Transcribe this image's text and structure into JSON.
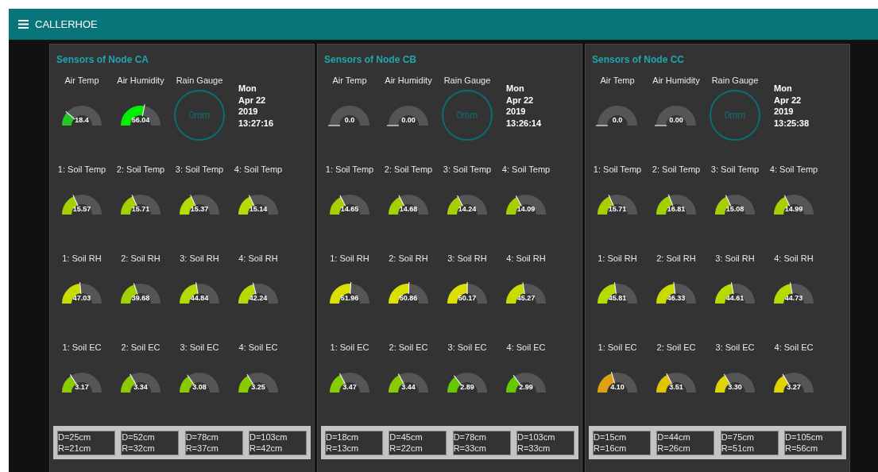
{
  "header": {
    "title": "CALLERHOE"
  },
  "nodes": [
    {
      "title": "Sensors of Node CA",
      "air_gauges": [
        {
          "label": "Air Temp",
          "value": "18.4",
          "color": "#22c822"
        },
        {
          "label": "Air Humidity",
          "value": "56.04",
          "color": "#00ee00"
        }
      ],
      "rain_gauge": {
        "label": "Rain Gauge",
        "reading": "0mm"
      },
      "date_lines": [
        "Mon",
        "Apr 22",
        "2019",
        "13:27:16"
      ],
      "rows": [
        {
          "gauges": [
            {
              "label": "1: Soil Temp",
              "value": "15.57",
              "color": "#a4d000"
            },
            {
              "label": "2: Soil Temp",
              "value": "15.71",
              "color": "#a4d000"
            },
            {
              "label": "3: Soil Temp",
              "value": "15.37",
              "color": "#b4dc00"
            },
            {
              "label": "4: Soil Temp",
              "value": "15.14",
              "color": "#b4dc00"
            }
          ]
        },
        {
          "gauges": [
            {
              "label": "1: Soil RH",
              "value": "47.03",
              "color": "#c8dc00"
            },
            {
              "label": "2: Soil RH",
              "value": "39.68",
              "color": "#a4d000"
            },
            {
              "label": "3: Soil RH",
              "value": "44.84",
              "color": "#b4dc00"
            },
            {
              "label": "4: Soil RH",
              "value": "42.24",
              "color": "#b4dc00"
            }
          ]
        },
        {
          "gauges": [
            {
              "label": "1: Soil EC",
              "value": "3.17",
              "color": "#88cc00"
            },
            {
              "label": "2: Soil EC",
              "value": "3.34",
              "color": "#88cc00"
            },
            {
              "label": "3: Soil EC",
              "value": "3.08",
              "color": "#88cc00"
            },
            {
              "label": "4: Soil EC",
              "value": "3.25",
              "color": "#88cc00"
            }
          ]
        }
      ],
      "distances": [
        {
          "d": "D=25cm",
          "r": "R=21cm"
        },
        {
          "d": "D=52cm",
          "r": "R=32cm"
        },
        {
          "d": "D=78cm",
          "r": "R=37cm"
        },
        {
          "d": "D=103cm",
          "r": "R=42cm"
        }
      ]
    },
    {
      "title": "Sensors of Node CB",
      "air_gauges": [
        {
          "label": "Air Temp",
          "value": "0.0"
        },
        {
          "label": "Air Humidity",
          "value": "0.00"
        }
      ],
      "rain_gauge": {
        "label": "Rain Gauge",
        "reading": "0mm"
      },
      "date_lines": [
        "Mon",
        "Apr 22",
        "2019",
        "13:26:14"
      ],
      "rows": [
        {
          "gauges": [
            {
              "label": "1: Soil Temp",
              "value": "14.65",
              "color": "#a4d000"
            },
            {
              "label": "2: Soil Temp",
              "value": "14.68",
              "color": "#a4d000"
            },
            {
              "label": "3: Soil Temp",
              "value": "14.24",
              "color": "#a4d000"
            },
            {
              "label": "4: Soil Temp",
              "value": "14.09",
              "color": "#a4d000"
            }
          ]
        },
        {
          "gauges": [
            {
              "label": "1: Soil RH",
              "value": "51.96",
              "color": "#dce000"
            },
            {
              "label": "2: Soil RH",
              "value": "50.86",
              "color": "#dce000"
            },
            {
              "label": "3: Soil RH",
              "value": "50.17",
              "color": "#dce000"
            },
            {
              "label": "4: Soil RH",
              "value": "45.27",
              "color": "#c8dc00"
            }
          ]
        },
        {
          "gauges": [
            {
              "label": "1: Soil EC",
              "value": "3.47",
              "color": "#88cc00"
            },
            {
              "label": "2: Soil EC",
              "value": "3.44",
              "color": "#88cc00"
            },
            {
              "label": "3: Soil EC",
              "value": "2.89",
              "color": "#66c800"
            },
            {
              "label": "4: Soil EC",
              "value": "2.99",
              "color": "#66c800"
            }
          ]
        }
      ],
      "distances": [
        {
          "d": "D=18cm",
          "r": "R=13cm"
        },
        {
          "d": "D=45cm",
          "r": "R=22cm"
        },
        {
          "d": "D=78cm",
          "r": "R=33cm"
        },
        {
          "d": "D=103cm",
          "r": "R=33cm"
        }
      ]
    },
    {
      "title": "Sensors of Node CC",
      "air_gauges": [
        {
          "label": "Air Temp",
          "value": "0.0"
        },
        {
          "label": "Air Humidity",
          "value": "0.00"
        }
      ],
      "rain_gauge": {
        "label": "Rain Gauge",
        "reading": "0mm"
      },
      "date_lines": [
        "Mon",
        "Apr 22",
        "2019",
        "13:25:38"
      ],
      "rows": [
        {
          "gauges": [
            {
              "label": "1: Soil Temp",
              "value": "15.71",
              "color": "#a4d000"
            },
            {
              "label": "2: Soil Temp",
              "value": "16.81",
              "color": "#a4d000"
            },
            {
              "label": "3: Soil Temp",
              "value": "15.08",
              "color": "#a4d000"
            },
            {
              "label": "4: Soil Temp",
              "value": "14.99",
              "color": "#a4d000"
            }
          ]
        },
        {
          "gauges": [
            {
              "label": "1: Soil RH",
              "value": "45.81",
              "color": "#b4dc00"
            },
            {
              "label": "2: Soil RH",
              "value": "46.33",
              "color": "#c8dc00"
            },
            {
              "label": "3: Soil RH",
              "value": "44.61",
              "color": "#b4dc00"
            },
            {
              "label": "4: Soil RH",
              "value": "44.73",
              "color": "#b4dc00"
            }
          ]
        },
        {
          "gauges": [
            {
              "label": "1: Soil EC",
              "value": "4.10",
              "color": "#e0a010"
            },
            {
              "label": "2: Soil EC",
              "value": "3.51",
              "color": "#e0c400"
            },
            {
              "label": "3: Soil EC",
              "value": "3.30",
              "color": "#e0d400"
            },
            {
              "label": "4: Soil EC",
              "value": "3.27",
              "color": "#e0d400"
            }
          ]
        }
      ],
      "distances": [
        {
          "d": "D=15cm",
          "r": "R=16cm"
        },
        {
          "d": "D=44cm",
          "r": "R=26cm"
        },
        {
          "d": "D=75cm",
          "r": "R=51cm"
        },
        {
          "d": "D=105cm",
          "r": "R=56cm"
        }
      ]
    }
  ]
}
